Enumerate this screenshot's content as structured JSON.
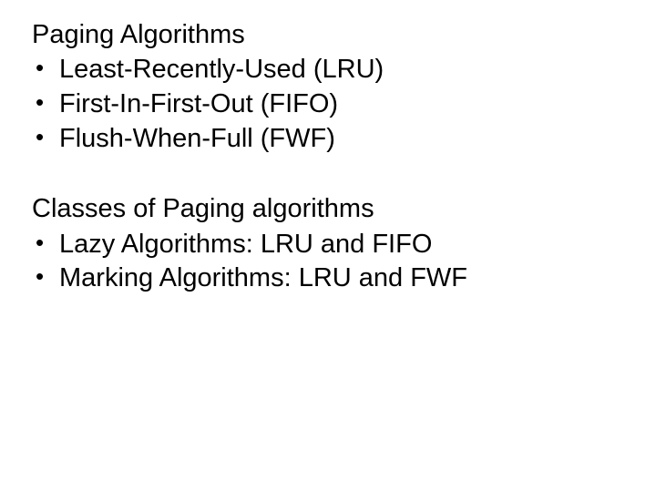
{
  "section1": {
    "heading": "Paging Algorithms",
    "items": [
      "Least-Recently-Used (LRU)",
      "First-In-First-Out (FIFO)",
      "Flush-When-Full (FWF)"
    ]
  },
  "section2": {
    "heading": "Classes of Paging algorithms",
    "items": [
      "Lazy Algorithms: LRU and FIFO",
      "Marking Algorithms: LRU and FWF"
    ]
  }
}
